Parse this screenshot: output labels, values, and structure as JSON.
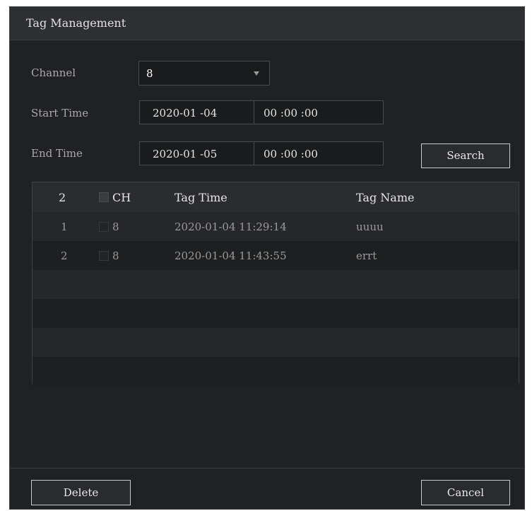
{
  "dialog": {
    "title": "Tag Management"
  },
  "filters": {
    "channel_label": "Channel",
    "channel_value": "8",
    "start_label": "Start Time",
    "start_date": "2020-01 -04",
    "start_time": "00 :00 :00",
    "end_label": "End Time",
    "end_date": "2020-01 -05",
    "end_time": "00 :00 :00",
    "search_label": "Search"
  },
  "table": {
    "count": "2",
    "headers": {
      "ch": "CH",
      "tag_time": "Tag Time",
      "tag_name": "Tag Name"
    },
    "rows": [
      {
        "index": "1",
        "ch": "8",
        "tag_time": "2020-01-04 11:29:14",
        "tag_name": "uuuu"
      },
      {
        "index": "2",
        "ch": "8",
        "tag_time": "2020-01-04 11:43:55",
        "tag_name": "errt"
      }
    ]
  },
  "footer": {
    "delete_label": "Delete",
    "cancel_label": "Cancel"
  }
}
